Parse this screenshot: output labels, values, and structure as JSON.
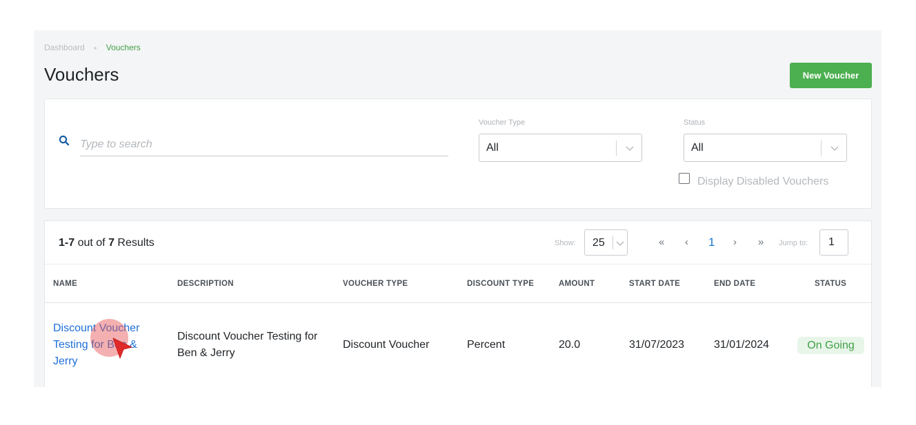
{
  "breadcrumb": {
    "home": "Dashboard",
    "separator": "▸",
    "current": "Vouchers"
  },
  "page": {
    "title": "Vouchers",
    "new_button": "New Voucher"
  },
  "filters": {
    "search_placeholder": "Type to search",
    "voucher_type": {
      "label": "Voucher Type",
      "value": "All"
    },
    "status": {
      "label": "Status",
      "value": "All"
    },
    "display_disabled_label": "Display Disabled Vouchers",
    "display_disabled_checked": false
  },
  "results": {
    "range": "1-7",
    "out_of": "out of",
    "total": "7",
    "suffix": "Results"
  },
  "pagination": {
    "show_label": "Show:",
    "page_size": "25",
    "first": "«",
    "prev": "‹",
    "current": "1",
    "next": "›",
    "last": "»",
    "jump_label": "Jump to:",
    "jump_value": "1"
  },
  "table": {
    "columns": [
      "NAME",
      "DESCRIPTION",
      "VOUCHER TYPE",
      "DISCOUNT TYPE",
      "AMOUNT",
      "START DATE",
      "END DATE",
      "STATUS"
    ],
    "rows": [
      {
        "name_line1": "Discount Voucher",
        "name_line2": "Testing for Ben &",
        "name_line3": "Jerry",
        "description_line1": "Discount Voucher Testing for",
        "description_line2": "Ben & Jerry",
        "voucher_type": "Discount Voucher",
        "discount_type": "Percent",
        "amount": "20.0",
        "start_date": "31/07/2023",
        "end_date": "31/01/2024",
        "status": "On Going"
      }
    ]
  },
  "colors": {
    "accent_green": "#4caf50",
    "link_blue": "#1e6fd9",
    "status_bg": "#e8f5e9"
  },
  "icons": {
    "search": "search-icon",
    "chevron": "chevron-down-icon",
    "cursor": "cursor-pointer-icon"
  }
}
